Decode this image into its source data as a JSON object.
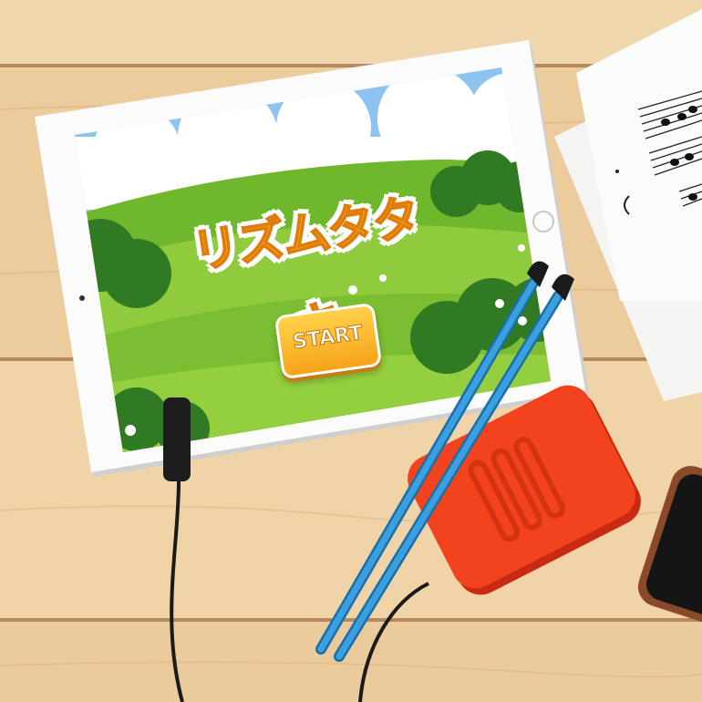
{
  "app": {
    "title": "リズムタタキ",
    "start_label": "START"
  },
  "colors": {
    "sky": "#8dc4ef",
    "hill_light": "#7fc12f",
    "hill_dark": "#3f8a2a",
    "button_yellow": "#f6a31a",
    "drumsticks": "#2a8fd0",
    "pad": "#f1401c",
    "wood": "#e9c79a"
  },
  "icons": [
    "home-button-icon",
    "camera-icon",
    "flower-icon"
  ]
}
